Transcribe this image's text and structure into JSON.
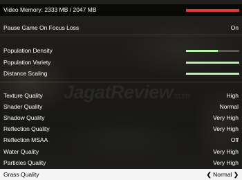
{
  "video_memory": {
    "label": "Video Memory: 2333 MB / 2047 MB",
    "used_fraction": 1.0,
    "bar_color": "#e03b3b"
  },
  "settings": [
    {
      "label": "Pause Game On Focus Loss",
      "value": "On"
    },
    {
      "label": "Population Density",
      "slider": 0.6
    },
    {
      "label": "Population Variety",
      "slider": 1.0
    },
    {
      "label": "Distance Scaling",
      "slider": 1.0
    },
    {
      "label": "Texture Quality",
      "value": "High"
    },
    {
      "label": "Shader Quality",
      "value": "Normal"
    },
    {
      "label": "Shadow Quality",
      "value": "Very High"
    },
    {
      "label": "Reflection Quality",
      "value": "Very High"
    },
    {
      "label": "Reflection MSAA",
      "value": "Off"
    },
    {
      "label": "Water Quality",
      "value": "Very High"
    },
    {
      "label": "Particles Quality",
      "value": "Very High"
    },
    {
      "label": "Grass Quality",
      "value": "Normal",
      "selected": true,
      "left_arrow": "❮",
      "right_arrow": "❯"
    }
  ],
  "watermark": {
    "main": "JagatReview",
    "suffix": ".com"
  },
  "colors": {
    "slider_fill": "#b6f2ac",
    "selected_bg": "#f4f4f4"
  }
}
